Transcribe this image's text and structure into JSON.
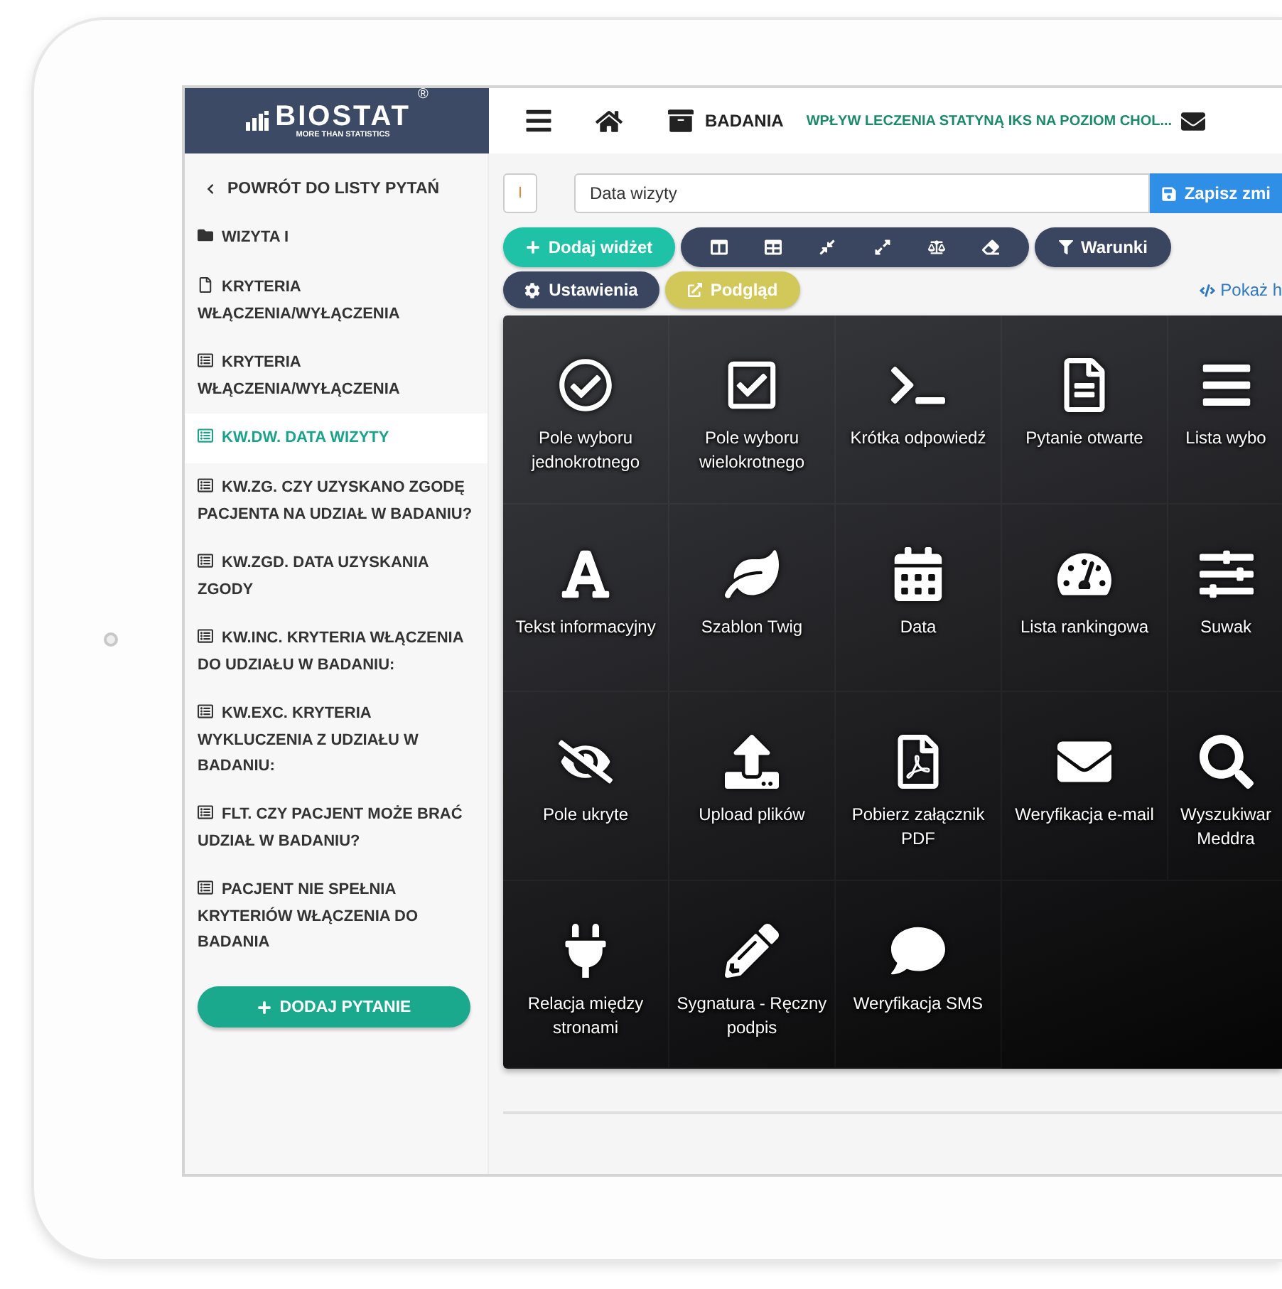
{
  "logo": {
    "name": "BIOSTAT",
    "mark": "®",
    "tagline": "MORE THAN STATISTICS"
  },
  "header": {
    "section": "BADANIA",
    "study_title": "WPŁYW LECZENIA STATYNĄ IKS NA POZIOM CHOL..."
  },
  "sidebar": {
    "back_link": "POWRÓT DO LISTY PYTAŃ",
    "items": [
      {
        "kind": "folder",
        "label": "WIZYTA I",
        "selected": false
      },
      {
        "kind": "page",
        "label": "KRYTERIA WŁĄCZENIA/WYŁĄCZENIA",
        "selected": false
      },
      {
        "kind": "question",
        "label": "KRYTERIA WŁĄCZENIA/WYŁĄCZENIA",
        "selected": false
      },
      {
        "kind": "question",
        "label": "KW.DW. DATA WIZYTY",
        "selected": true
      },
      {
        "kind": "question",
        "label": "KW.ZG. CZY UZYSKANO ZGODĘ PACJENTA NA UDZIAŁ W BADANIU?",
        "selected": false
      },
      {
        "kind": "question",
        "label": "KW.ZGD. DATA UZYSKANIA ZGODY",
        "selected": false
      },
      {
        "kind": "question",
        "label": "KW.INC. KRYTERIA WŁĄCZENIA DO UDZIAŁU W BADANIU:",
        "selected": false
      },
      {
        "kind": "question",
        "label": "KW.EXC. KRYTERIA WYKLUCZENIA Z UDZIAŁU W BADANIU:",
        "selected": false
      },
      {
        "kind": "question",
        "label": "FLT. CZY PACJENT MOŻE BRAĆ UDZIAŁ W BADANIU?",
        "selected": false
      },
      {
        "kind": "question",
        "label": "PACJENT NIE SPEŁNIA KRYTERIÓW WŁĄCZENIA DO BADANIA",
        "selected": false
      }
    ],
    "add_button": "DODAJ PYTANIE"
  },
  "editor": {
    "label_badge": "I",
    "title_field": {
      "value": "Data wizyty"
    },
    "save_button": "Zapisz zmi",
    "add_widget_button": "Dodaj widżet",
    "conditions_button": "Warunki",
    "settings_button": "Ustawienia",
    "preview_button": "Podgląd",
    "source_link": "Pokaż h"
  },
  "widgets": [
    {
      "label": "Pole wyboru jednokrotnego"
    },
    {
      "label": "Pole wyboru wielokrotnego"
    },
    {
      "label": "Krótka odpowiedź"
    },
    {
      "label": "Pytanie otwarte"
    },
    {
      "label": "Lista wybo"
    },
    {
      "label": "Tekst informacyjny"
    },
    {
      "label": "Szablon Twig"
    },
    {
      "label": "Data"
    },
    {
      "label": "Lista rankingowa"
    },
    {
      "label": "Suwak"
    },
    {
      "label": "Pole ukryte"
    },
    {
      "label": "Upload plików"
    },
    {
      "label": "Pobierz załącznik PDF"
    },
    {
      "label": "Weryfikacja e-mail"
    },
    {
      "label": "Wyszukiwar Meddra"
    },
    {
      "label": "Relacja między stronami"
    },
    {
      "label": "Sygnatura - Ręczny podpis"
    },
    {
      "label": "Weryfikacja SMS"
    }
  ]
}
